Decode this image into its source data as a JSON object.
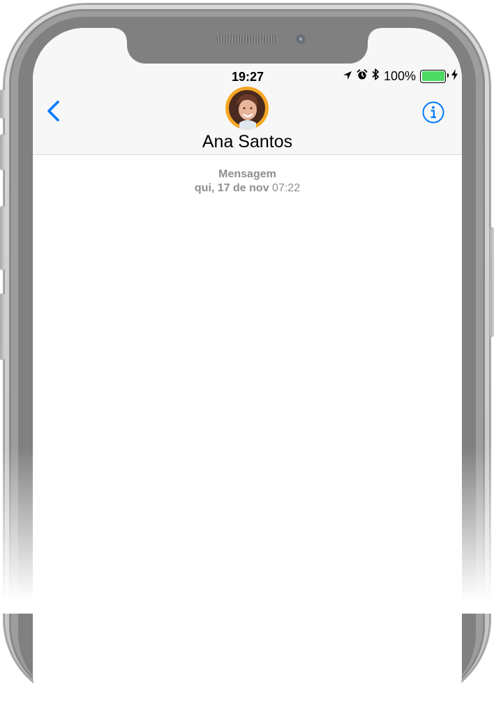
{
  "status_bar": {
    "time": "19:27",
    "battery_percent": "100%",
    "battery_level": 1.0,
    "battery_color": "#4cd964",
    "icons": [
      "location-arrow-icon",
      "alarm-icon",
      "bluetooth-icon",
      "battery-icon",
      "charging-bolt-icon"
    ]
  },
  "nav": {
    "back_icon": "chevron-left-icon",
    "info_icon": "info-circle-icon",
    "accent_color": "#007aff"
  },
  "contact": {
    "name": "Ana Santos",
    "avatar_ring_color": "#f5a623"
  },
  "thread": {
    "label": "Mensagem",
    "date": "qui, 17 de nov",
    "time": "07:22"
  }
}
